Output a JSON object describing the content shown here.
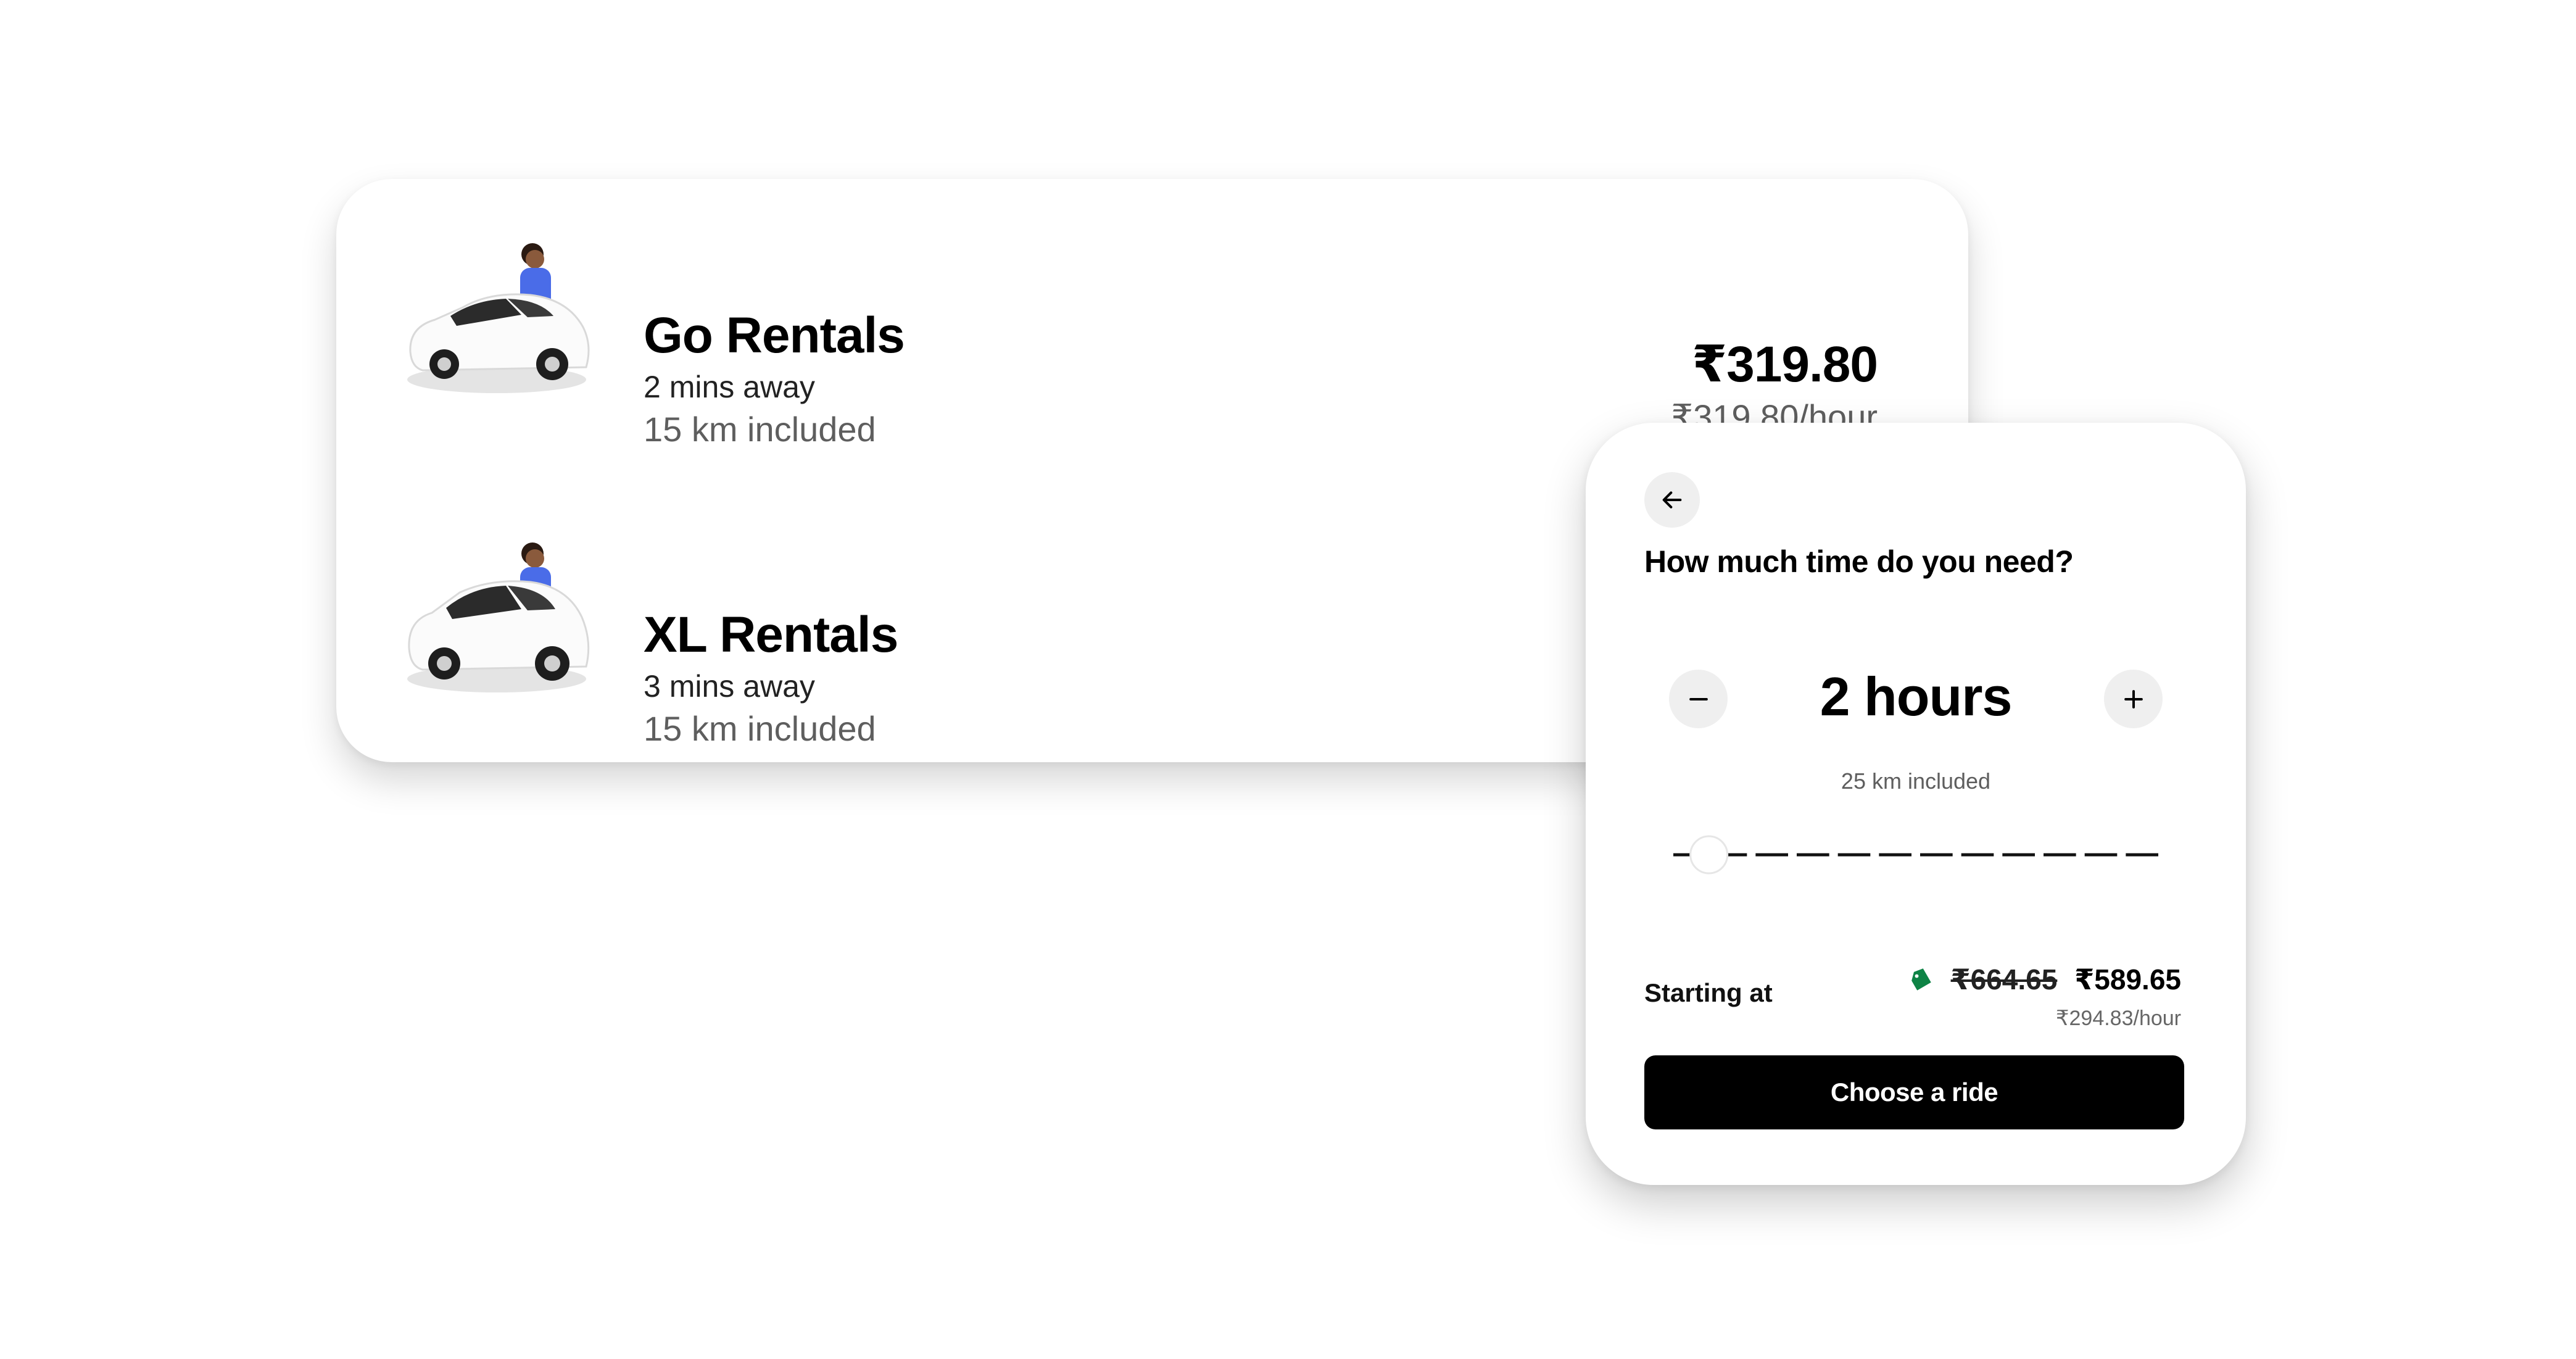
{
  "rides": [
    {
      "name": "Go Rentals",
      "eta": "2 mins away",
      "km": "15 km included",
      "price": "₹319.80",
      "rate": "₹319.80/hour",
      "icon": "hatchback-car-illustration"
    },
    {
      "name": "XL Rentals",
      "eta": "3 mins away",
      "km": "15 km included",
      "icon": "suv-car-illustration"
    }
  ],
  "time_selector": {
    "back_icon": "arrow-left-icon",
    "question": "How much time do you need?",
    "duration": "2 hours",
    "km_included": "25 km included",
    "slider": {
      "value": 2,
      "min": 1,
      "max": 12,
      "steps": 12
    },
    "starting_label": "Starting at",
    "discount_icon": "price-tag-icon",
    "old_price": "₹664.65",
    "new_price": "₹589.65",
    "hourly_rate": "₹294.83/hour",
    "cta_label": "Choose a ride"
  },
  "colors": {
    "accent": "#000000",
    "discount_green": "#0e8345",
    "driver_shirt": "#4a6ce8",
    "muted_text": "#5e5e5e"
  }
}
